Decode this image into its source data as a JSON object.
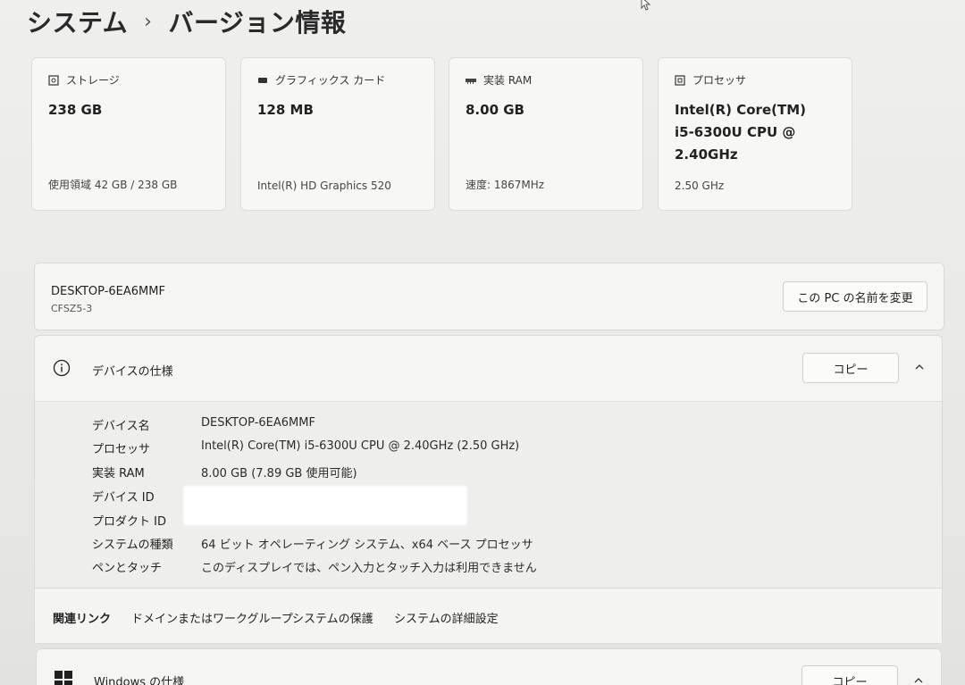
{
  "breadcrumb": {
    "parent": "システム",
    "separator": "›",
    "current": "バージョン情報"
  },
  "cards": {
    "storage": {
      "title": "ストレージ",
      "value": "238 GB",
      "sub": "使用領域 42 GB / 238 GB"
    },
    "graphics": {
      "title": "グラフィックス カード",
      "value": "128 MB",
      "sub": "Intel(R) HD Graphics 520"
    },
    "ram": {
      "title": "実装 RAM",
      "value": "8.00 GB",
      "sub": "速度: 1867MHz"
    },
    "cpu": {
      "title": "プロセッサ",
      "value_line1": "Intel(R) Core(TM)",
      "value_line2": "i5-6300U CPU @",
      "value_line3": "2.40GHz",
      "sub": "2.50 GHz"
    }
  },
  "device": {
    "name": "DESKTOP-6EA6MMF",
    "model": "CFSZ5-3",
    "rename_label": "この PC の名前を変更"
  },
  "device_spec": {
    "title": "デバイスの仕様",
    "copy_label": "コピー",
    "rows": [
      {
        "key": "デバイス名",
        "value": "DESKTOP-6EA6MMF"
      },
      {
        "key": "プロセッサ",
        "value": "Intel(R) Core(TM) i5-6300U CPU @ 2.40GHz (2.50 GHz)"
      },
      {
        "key": "実装 RAM",
        "value": "8.00 GB (7.89 GB 使用可能)"
      },
      {
        "key": "デバイス ID",
        "value": ""
      },
      {
        "key": "プロダクト ID",
        "value": ""
      },
      {
        "key": "システムの種類",
        "value": "64 ビット オペレーティング システム、x64 ベース プロセッサ"
      },
      {
        "key": "ペンとタッチ",
        "value": "このディスプレイでは、ペン入力とタッチ入力は利用できません"
      }
    ]
  },
  "related_links": {
    "label": "関連リンク",
    "items": [
      "ドメインまたはワークグループ",
      "システムの保護",
      "システムの詳細設定"
    ]
  },
  "windows_spec": {
    "title": "Windows の仕様",
    "copy_label": "コピー"
  }
}
